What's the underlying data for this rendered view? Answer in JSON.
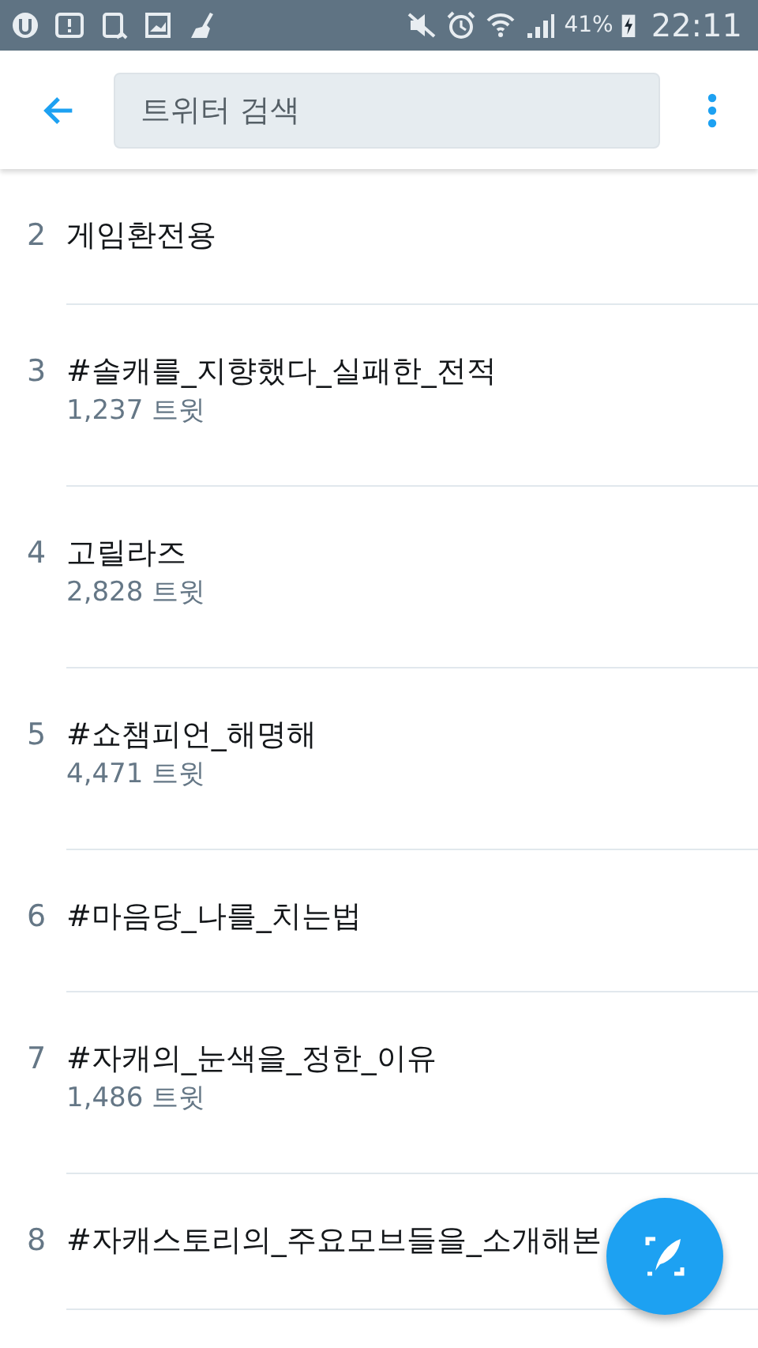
{
  "status_bar": {
    "battery": "41%",
    "time": "22:11"
  },
  "search": {
    "placeholder": "트위터 검색"
  },
  "trends": [
    {
      "rank": "2",
      "name": "게임환전용"
    },
    {
      "rank": "3",
      "name": "#솔캐를_지향했다_실패한_전적",
      "count": "1,237 트윗"
    },
    {
      "rank": "4",
      "name": "고릴라즈",
      "count": "2,828 트윗"
    },
    {
      "rank": "5",
      "name": "#쇼챔피언_해명해",
      "count": "4,471 트윗"
    },
    {
      "rank": "6",
      "name": "#마음당_나를_치는법"
    },
    {
      "rank": "7",
      "name": "#자캐의_눈색을_정한_이유",
      "count": "1,486 트윗"
    },
    {
      "rank": "8",
      "name": "#자캐스토리의_주요모브들을_소개해본"
    }
  ]
}
